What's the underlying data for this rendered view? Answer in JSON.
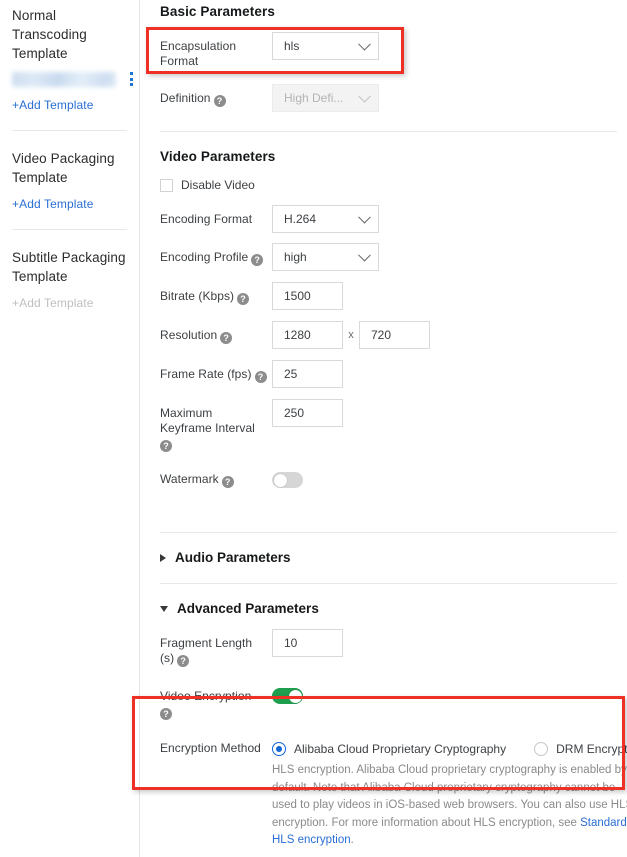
{
  "sidebar": {
    "groups": [
      {
        "name": "normal-transcoding-template",
        "title_line1": "Normal Transcoding",
        "title_line2": "Template",
        "has_item": true,
        "item_name": "",
        "kebab": "more-options-icon",
        "add_label": "+Add Template",
        "add_disabled": false
      },
      {
        "name": "video-packaging-template",
        "title_line1": "Video Packaging",
        "title_line2": "Template",
        "has_item": false,
        "add_label": "+Add Template",
        "add_disabled": false
      },
      {
        "name": "subtitle-packaging-template",
        "title_line1": "Subtitle Packaging",
        "title_line2": "Template",
        "has_item": false,
        "add_label": "+Add Template",
        "add_disabled": true
      }
    ]
  },
  "basic": {
    "heading": "Basic Parameters",
    "encapsulation": {
      "label_line1": "Encapsulation",
      "label_line2": "Format",
      "value": "hls"
    },
    "definition": {
      "label": "Definition",
      "value": "High Defi...",
      "disabled": true
    }
  },
  "video": {
    "heading": "Video Parameters",
    "disable_video_label": "Disable Video",
    "disable_video_checked": false,
    "encoding_format": {
      "label": "Encoding Format",
      "value": "H.264"
    },
    "encoding_profile": {
      "label": "Encoding Profile",
      "value": "high"
    },
    "bitrate": {
      "label": "Bitrate (Kbps)",
      "value": "1500"
    },
    "resolution": {
      "label": "Resolution",
      "width": "1280",
      "sep": "x",
      "height": "720"
    },
    "frame_rate": {
      "label": "Frame Rate (fps)",
      "value": "25"
    },
    "keyframe": {
      "label_line1": "Maximum",
      "label_line2": "Keyframe Interval",
      "value": "250"
    },
    "watermark": {
      "label": "Watermark",
      "on": false
    }
  },
  "audio": {
    "heading": "Audio Parameters",
    "expanded": false
  },
  "advanced": {
    "heading": "Advanced Parameters",
    "expanded": true,
    "fragment_length": {
      "label_line1": "Fragment Length",
      "label_line2": "(s)",
      "value": "10"
    },
    "video_encryption": {
      "label": "Video Encryption",
      "on": true
    },
    "encryption_method": {
      "label": "Encryption Method",
      "options": [
        {
          "label": "Alibaba Cloud Proprietary Cryptography",
          "selected": true
        },
        {
          "label": "DRM Encryption",
          "selected": false
        }
      ]
    },
    "help_text": "HLS encryption. Alibaba Cloud proprietary cryptography is enabled by default. Note that Alibaba Cloud proprietary cryptography cannot be used to play videos in iOS-based web browsers. You can also use HLS encryption. For more information about HLS encryption, see ",
    "help_link": "Standard HLS encryption",
    "help_tail": "."
  },
  "colors": {
    "link": "#2a6ed4",
    "accent_blue": "#1565c0",
    "toggle_on": "#1e9e4f",
    "radio_on": "#1366d6",
    "annotation_red": "#ee3124"
  }
}
